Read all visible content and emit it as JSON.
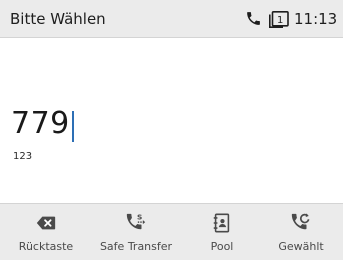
{
  "status_bar": {
    "title": "Bitte Wählen",
    "time": "11:13",
    "line_number": "1",
    "icons": [
      "phone-handset-icon",
      "line-indicator-icon"
    ]
  },
  "dial": {
    "number": "779",
    "input_mode": "123"
  },
  "softkeys": [
    {
      "label": "Rücktaste",
      "icon": "backspace-icon"
    },
    {
      "label": "Safe Transfer",
      "icon": "safe-transfer-icon"
    },
    {
      "label": "Pool",
      "icon": "contact-book-icon"
    },
    {
      "label": "Gewählt",
      "icon": "redial-icon"
    }
  ],
  "colors": {
    "bar_background": "#ebebeb",
    "icon_color": "#4a4a4a",
    "cursor_color": "#2d6fb5",
    "text_color": "#1e1e1e"
  }
}
